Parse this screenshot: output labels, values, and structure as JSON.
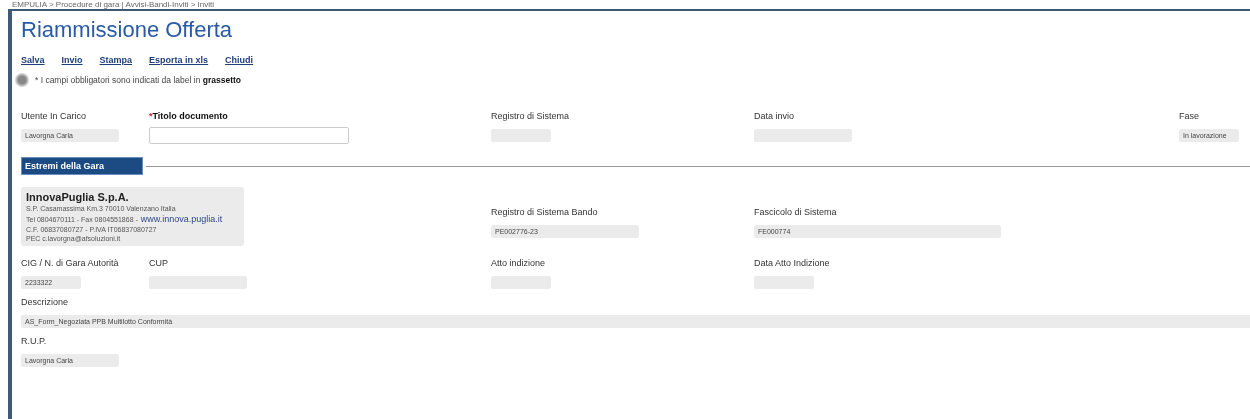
{
  "breadcrumb": "EMPULIA > Procedure di gara | Avvisi-Bandi-Inviti > Inviti",
  "title": "Riammissione Offerta",
  "toolbar": [
    "Salva",
    "Invio",
    "Stampa",
    "Esporta in xls",
    "Chiudi"
  ],
  "note": "* I campi obbligatori sono indicati da label in **grassetto**",
  "header_fields": [
    {
      "label": "Utente In Carico",
      "value": "Lavorgna Carla",
      "kind": "readonly",
      "required": false
    },
    {
      "label": "Titolo documento",
      "kind": "input",
      "required": true,
      "required_mark": "*"
    },
    {
      "label": "Registro di Sistema",
      "kind": "readonly",
      "required": false
    },
    {
      "label": "Data invio",
      "kind": "readonly",
      "required": false
    },
    {
      "label": "Fase",
      "value": "In lavorazione",
      "kind": "readonly",
      "required": false
    }
  ],
  "section": {
    "title": "Estremi della Gara"
  },
  "company": {
    "name": "InnovaPuglia S.p.A.",
    "address": "S.P. Casamassima Km.3 70010 Valenzano Italia",
    "phone": "Tel 0804670111 - Fax 0804551868 -",
    "website": "www.innova.puglia.it",
    "tax": "C.F. 06837080727 - P.IVA IT06837080727",
    "pec": "PEC c.lavorgna@afsoluzioni.it"
  },
  "company_fields": [
    {
      "label": "Registro di Sistema Bando",
      "value": "PE002776-23",
      "kind": "readonly"
    },
    {
      "label": "Fascicolo di Sistema",
      "value": "FE000774",
      "kind": "readonly"
    }
  ],
  "gara_fields": [
    {
      "label": "CIG / N. di Gara Autorità",
      "value": "2233322",
      "kind": "readonly"
    },
    {
      "label": "CUP",
      "kind": "readonly"
    },
    {
      "label": "Atto indizione",
      "kind": "readonly"
    },
    {
      "label": "Data Atto Indizione",
      "kind": "readonly"
    }
  ],
  "description": {
    "label": "Descrizione",
    "value": "AS_Form_Negoziata PPB Multilotto Conformità",
    "kind": "readonly"
  },
  "rup": {
    "label": "R.U.P.",
    "value": "Lavorgna Carla",
    "kind": "readonly"
  }
}
